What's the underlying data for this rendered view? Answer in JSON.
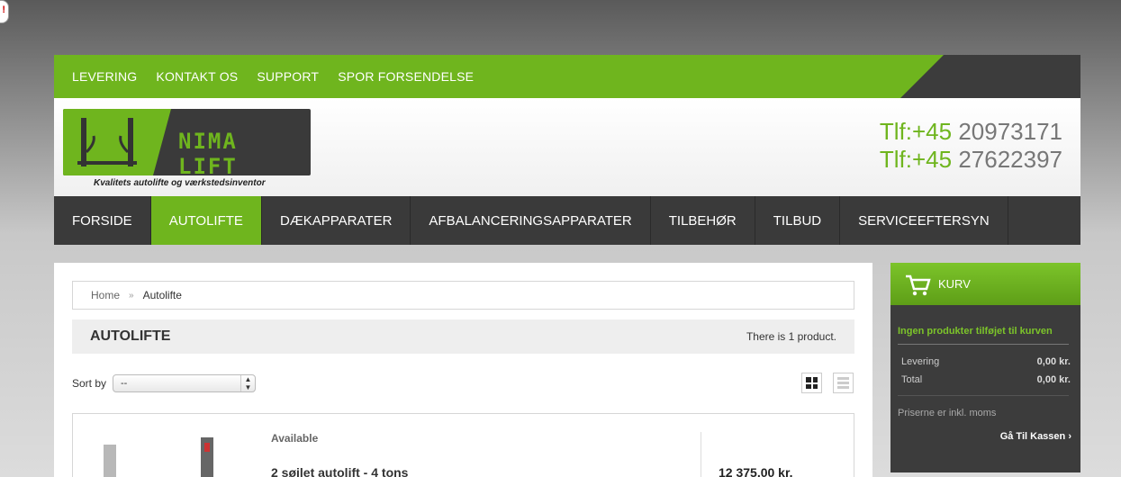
{
  "topnav": [
    "LEVERING",
    "KONTAKT OS",
    "SUPPORT",
    "SPOR FORSENDELSE"
  ],
  "header": {
    "brand": "NIMA LIFT",
    "tagline": "Kvalitets autolifte og værkstedsinventor",
    "phones": [
      {
        "prefix": "Tlf:+45",
        "number": "20973171"
      },
      {
        "prefix": "Tlf:+45",
        "number": "27622397"
      }
    ]
  },
  "mainnav": [
    "FORSIDE",
    "AUTOLIFTE",
    "DÆKAPPARATER",
    "AFBALANCERINGSAPPARATER",
    "TILBEHØR",
    "TILBUD",
    "SERVICEEFTERSYN"
  ],
  "mainnav_active": "AUTOLIFTE",
  "breadcrumb": {
    "home": "Home",
    "separator": "»",
    "current": "Autolifte"
  },
  "category": {
    "title": "AUTOLIFTE",
    "count": "There is 1 product."
  },
  "sort": {
    "label": "Sort by",
    "value": "--"
  },
  "product": {
    "availability": "Available",
    "name": "2 søjlet autolift - 4 tons",
    "price": "12 375,00 kr."
  },
  "cart": {
    "title": "KURV",
    "empty": "Ingen produkter tilføjet til kurven",
    "rows": [
      {
        "label": "Levering",
        "value": "0,00 kr."
      },
      {
        "label": "Total",
        "value": "0,00 kr."
      }
    ],
    "tax_note": "Priserne er inkl. moms",
    "checkout": "Gå Til Kassen"
  },
  "colors": {
    "accent": "#6fb51e",
    "dark": "#3a3a3a"
  }
}
